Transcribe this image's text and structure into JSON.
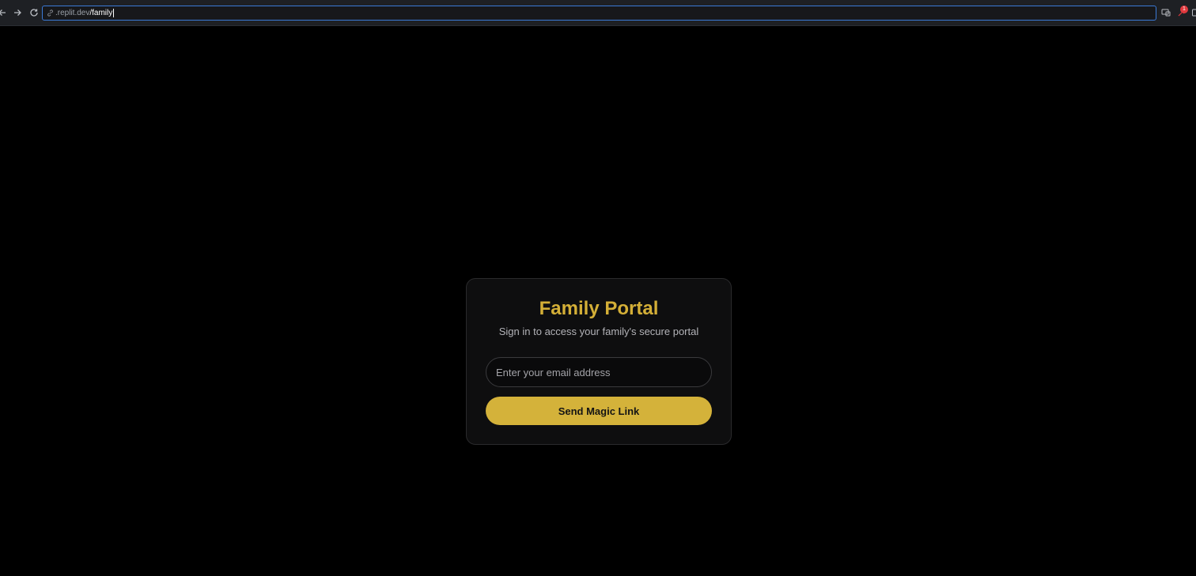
{
  "browser": {
    "url_host": ".replit.dev",
    "url_path": "/family",
    "badge_count": "1",
    "icons": {
      "back": "arrow-left-icon",
      "forward": "arrow-right-icon",
      "reload": "reload-icon",
      "link": "link-icon",
      "cast": "cast-icon",
      "extension": "extension-icon"
    }
  },
  "card": {
    "title": "Family Portal",
    "subtitle": "Sign in to access your family's secure portal",
    "email_placeholder": "Enter your email address",
    "email_value": "",
    "submit_label": "Send Magic Link"
  },
  "colors": {
    "accent": "#d4af37",
    "button": "#d4b23a",
    "background": "#000000",
    "card": "#0e0e0f"
  }
}
